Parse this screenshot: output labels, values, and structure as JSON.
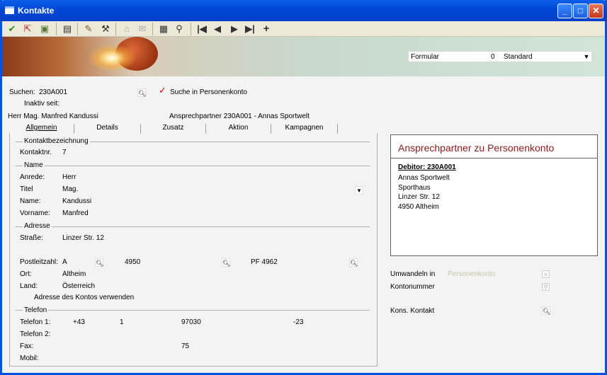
{
  "window": {
    "title": "Kontakte"
  },
  "toolbar": {
    "icons": [
      "check-icon",
      "exit-icon",
      "print-icon",
      "form-icon",
      "edit-icon",
      "tools-icon",
      "folder-icon",
      "mail-icon",
      "calendar-icon",
      "filter-icon",
      "first-icon",
      "prev-icon",
      "next-icon",
      "last-icon",
      "add-icon"
    ],
    "glyphs": {
      "check": "✔",
      "first": "|◀",
      "prev": "◀",
      "next": "▶",
      "last": "▶|",
      "add": "+"
    }
  },
  "formular": {
    "label": "Formular",
    "number": "0",
    "value": "Standard"
  },
  "search": {
    "label": "Suchen:",
    "value": "230A001",
    "checkbox_label": "Suche in Personenkonto",
    "check_glyph": "✓"
  },
  "inactive": {
    "label": "Inaktiv seit:"
  },
  "header": {
    "person": "Herr Mag. Manfred Kandussi",
    "partner": "Ansprechpartner 230A001 - Annas Sportwelt"
  },
  "tabs": [
    "Allgemein",
    "Details",
    "Zusatz",
    "Aktion",
    "Kampagnen"
  ],
  "groups": {
    "kontakt": "Kontaktbezeichnung",
    "name": "Name",
    "adresse": "Adresse",
    "telefon": "Telefon"
  },
  "fields": {
    "kontaktnr_label": "Kontaktnr.",
    "kontaktnr": "7",
    "anrede_label": "Anrede:",
    "anrede": "Herr",
    "titel_label": "Titel",
    "titel": "Mag.",
    "name_label": "Name:",
    "name": "Kandussi",
    "vorname_label": "Vorname:",
    "vorname": "Manfred",
    "strasse_label": "Straße:",
    "strasse": "Linzer Str. 12",
    "plz_label": "Postleitzahl:",
    "plz_country": "A",
    "plz": "4950",
    "pf": "PF 4962",
    "ort_label": "Ort:",
    "ort": "Altheim",
    "land_label": "Land:",
    "land": "Österreich",
    "adresse_konto": "Adresse des Kontos verwenden",
    "tel1_label": "Telefon 1:",
    "tel1_cc": "+43",
    "tel1_area": "1",
    "tel1_num": "97030",
    "tel1_ext": "-23",
    "tel2_label": "Telefon 2:",
    "fax_label": "Fax:",
    "fax_ext": "75",
    "mobil_label": "Mobil:"
  },
  "right_panel": {
    "heading": "Ansprechpartner zu Personenkonto",
    "debitor": "Debitor: 230A001",
    "lines": [
      "Annas Sportwelt",
      "Sporthaus",
      "Linzer Str. 12",
      "4950 Altheim"
    ]
  },
  "extra": {
    "umwandeln_label": "Umwandeln in",
    "umwandeln_value": "Personenkonto",
    "kontonummer_label": "Kontonummer",
    "kons_label": "Kons. Kontakt"
  }
}
